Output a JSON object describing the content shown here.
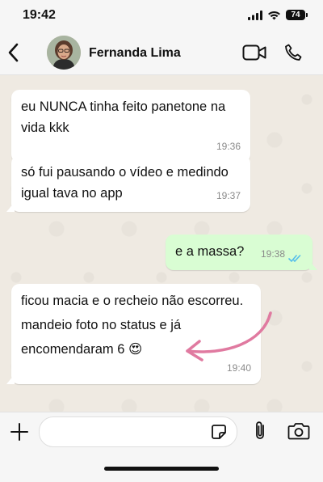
{
  "status_bar": {
    "time": "19:42",
    "battery": "74"
  },
  "header": {
    "contact_name": "Fernanda Lima"
  },
  "messages": [
    {
      "direction": "incoming",
      "text": "eu NUNCA tinha feito panetone na vida kkk",
      "time": "19:36"
    },
    {
      "direction": "incoming",
      "text": "só fui pausando o vídeo e medindo igual tava no app",
      "time": "19:37"
    },
    {
      "direction": "outgoing",
      "text": "e a massa?",
      "time": "19:38",
      "status": "read"
    },
    {
      "direction": "incoming",
      "text": "ficou macia e o recheio não escorreu. mandeio foto no status e já encomendaram 6",
      "emoji": "😍",
      "time": "19:40"
    }
  ],
  "input": {
    "placeholder": ""
  },
  "colors": {
    "chat_background": "#efeae2",
    "incoming_bubble": "#ffffff",
    "outgoing_bubble": "#d9fdd3",
    "read_ticks": "#53bdeb",
    "annotation_arrow": "#e07aa0"
  },
  "icons": [
    "back-icon",
    "video-call-icon",
    "voice-call-icon",
    "plus-icon",
    "sticker-icon",
    "attach-icon",
    "camera-icon",
    "signal-icon",
    "wifi-icon",
    "battery-icon"
  ]
}
